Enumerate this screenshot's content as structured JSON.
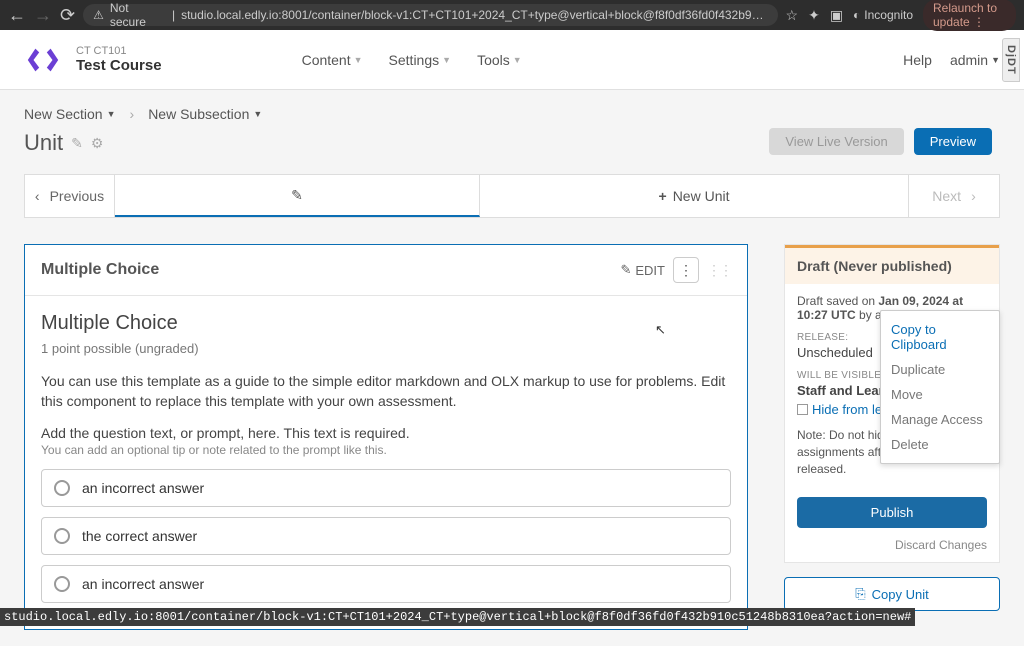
{
  "browser": {
    "insecure_label": "Not secure",
    "url": "studio.local.edly.io:8001/container/block-v1:CT+CT101+2024_CT+type@vertical+block@f8f0df36fd0f432b910c5...",
    "incognito": "Incognito",
    "relaunch": "Relaunch to update",
    "status_url": "studio.local.edly.io:8001/container/block-v1:CT+CT101+2024_CT+type@vertical+block@f8f0df36fd0f432b910c51248b8310ea?action=new#"
  },
  "header": {
    "course_code": "CT CT101",
    "course_name": "Test Course",
    "nav": {
      "content": "Content",
      "settings": "Settings",
      "tools": "Tools"
    },
    "help": "Help",
    "admin": "admin",
    "djdt": "DjDT"
  },
  "breadcrumb": {
    "section": "New Section",
    "subsection": "New Subsection"
  },
  "page": {
    "title": "Unit",
    "view_live": "View Live Version",
    "preview": "Preview"
  },
  "tabs": {
    "previous": "Previous",
    "new_unit": "New Unit",
    "next": "Next"
  },
  "component": {
    "title": "Multiple Choice",
    "edit": "EDIT",
    "problem_title": "Multiple Choice",
    "points": "1 point possible (ungraded)",
    "description": "You can use this template as a guide to the simple editor markdown and OLX markup to use for problems. Edit this component to replace this template with your own assessment.",
    "prompt": "Add the question text, or prompt, here. This text is required.",
    "tip": "You can add an optional tip or note related to the prompt like this.",
    "answers": [
      "an incorrect answer",
      "the correct answer",
      "an incorrect answer"
    ]
  },
  "dropdown": {
    "copy": "Copy to Clipboard",
    "duplicate": "Duplicate",
    "move": "Move",
    "manage": "Manage Access",
    "delete": "Delete"
  },
  "sidebar": {
    "status": "Draft (Never published)",
    "saved_prefix": "Draft saved on ",
    "saved_date": "Jan 09, 2024 at 10:27 UTC",
    "saved_by_prefix": " by ",
    "saved_user": "admin",
    "release_label": "RELEASE:",
    "release_value": "Unscheduled",
    "visible_label": "WILL BE VISIBLE TO:",
    "visible_value": "Staff and Learners",
    "hide_link": "Hide from learners",
    "note": "Note: Do not hide graded assignments after they have been released.",
    "publish": "Publish",
    "discard": "Discard Changes",
    "copy_unit": "Copy Unit"
  }
}
